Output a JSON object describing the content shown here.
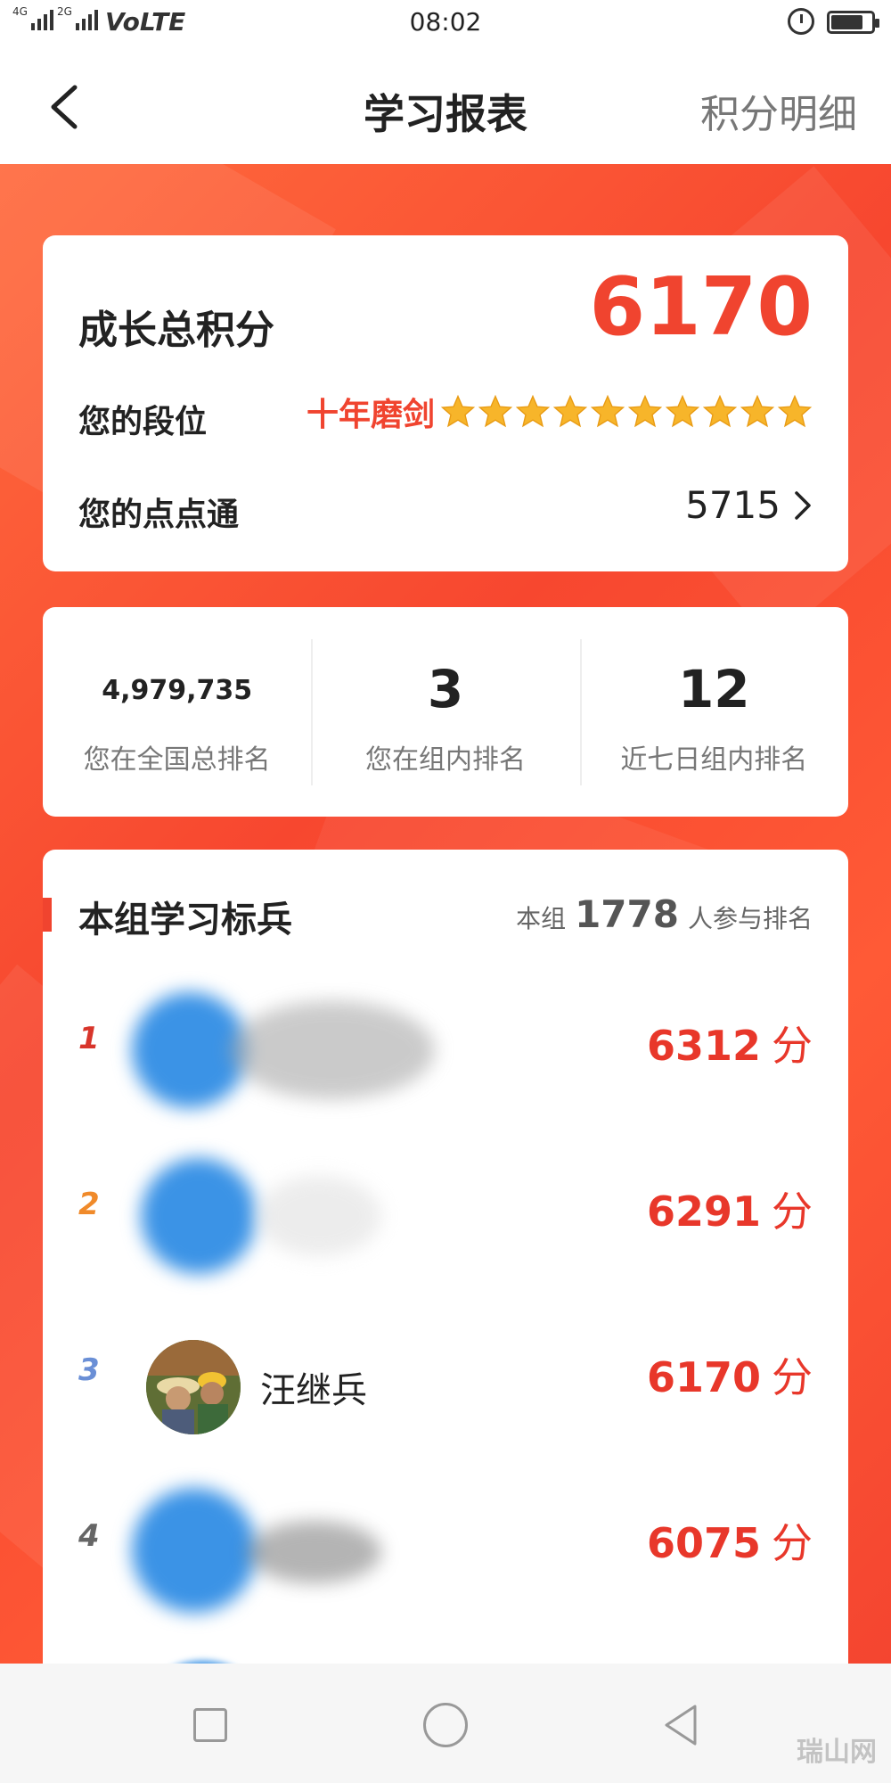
{
  "status_bar": {
    "network_1": "4G",
    "network_2": "2G",
    "volte": "VoLTE",
    "time": "08:02",
    "battery_level": 0.8
  },
  "nav": {
    "title": "学习报表",
    "right_action": "积分明细"
  },
  "score": {
    "total_label": "成长总积分",
    "total_value": "6170",
    "rank_label": "您的段位",
    "rank_name": "十年磨剑",
    "rank_stars": 10,
    "diandian_label": "您的点点通",
    "diandian_value": "5715"
  },
  "ranks": [
    {
      "value": "4,979,735",
      "caption": "您在全国总排名"
    },
    {
      "value": "3",
      "caption": "您在组内排名"
    },
    {
      "value": "12",
      "caption": "近七日组内排名"
    }
  ],
  "leaderboard": {
    "title": "本组学习标兵",
    "participants_prefix": "本组",
    "participants_count": "1778",
    "participants_suffix": "人参与排名",
    "entries": [
      {
        "rank": "1",
        "name": "",
        "points": "6312",
        "unit": "分",
        "rank_color": "#d8352b"
      },
      {
        "rank": "2",
        "name": "",
        "points": "6291",
        "unit": "分",
        "rank_color": "#f08a2a"
      },
      {
        "rank": "3",
        "name": "汪继兵",
        "points": "6170",
        "unit": "分",
        "rank_color": "#6a8fd6"
      },
      {
        "rank": "4",
        "name": "",
        "points": "6075",
        "unit": "分",
        "rank_color": "#666666"
      }
    ]
  },
  "watermark": "瑞山网",
  "colors": {
    "accent": "#f0442f",
    "hero_background": "#f7472f",
    "star": "#f7b52a"
  },
  "icons": {
    "back": "chevron-left-icon",
    "chevron": "chevron-right-icon",
    "star": "star-icon",
    "recent_apps": "square-icon",
    "home": "circle-icon",
    "back_nav": "triangle-back-icon"
  }
}
